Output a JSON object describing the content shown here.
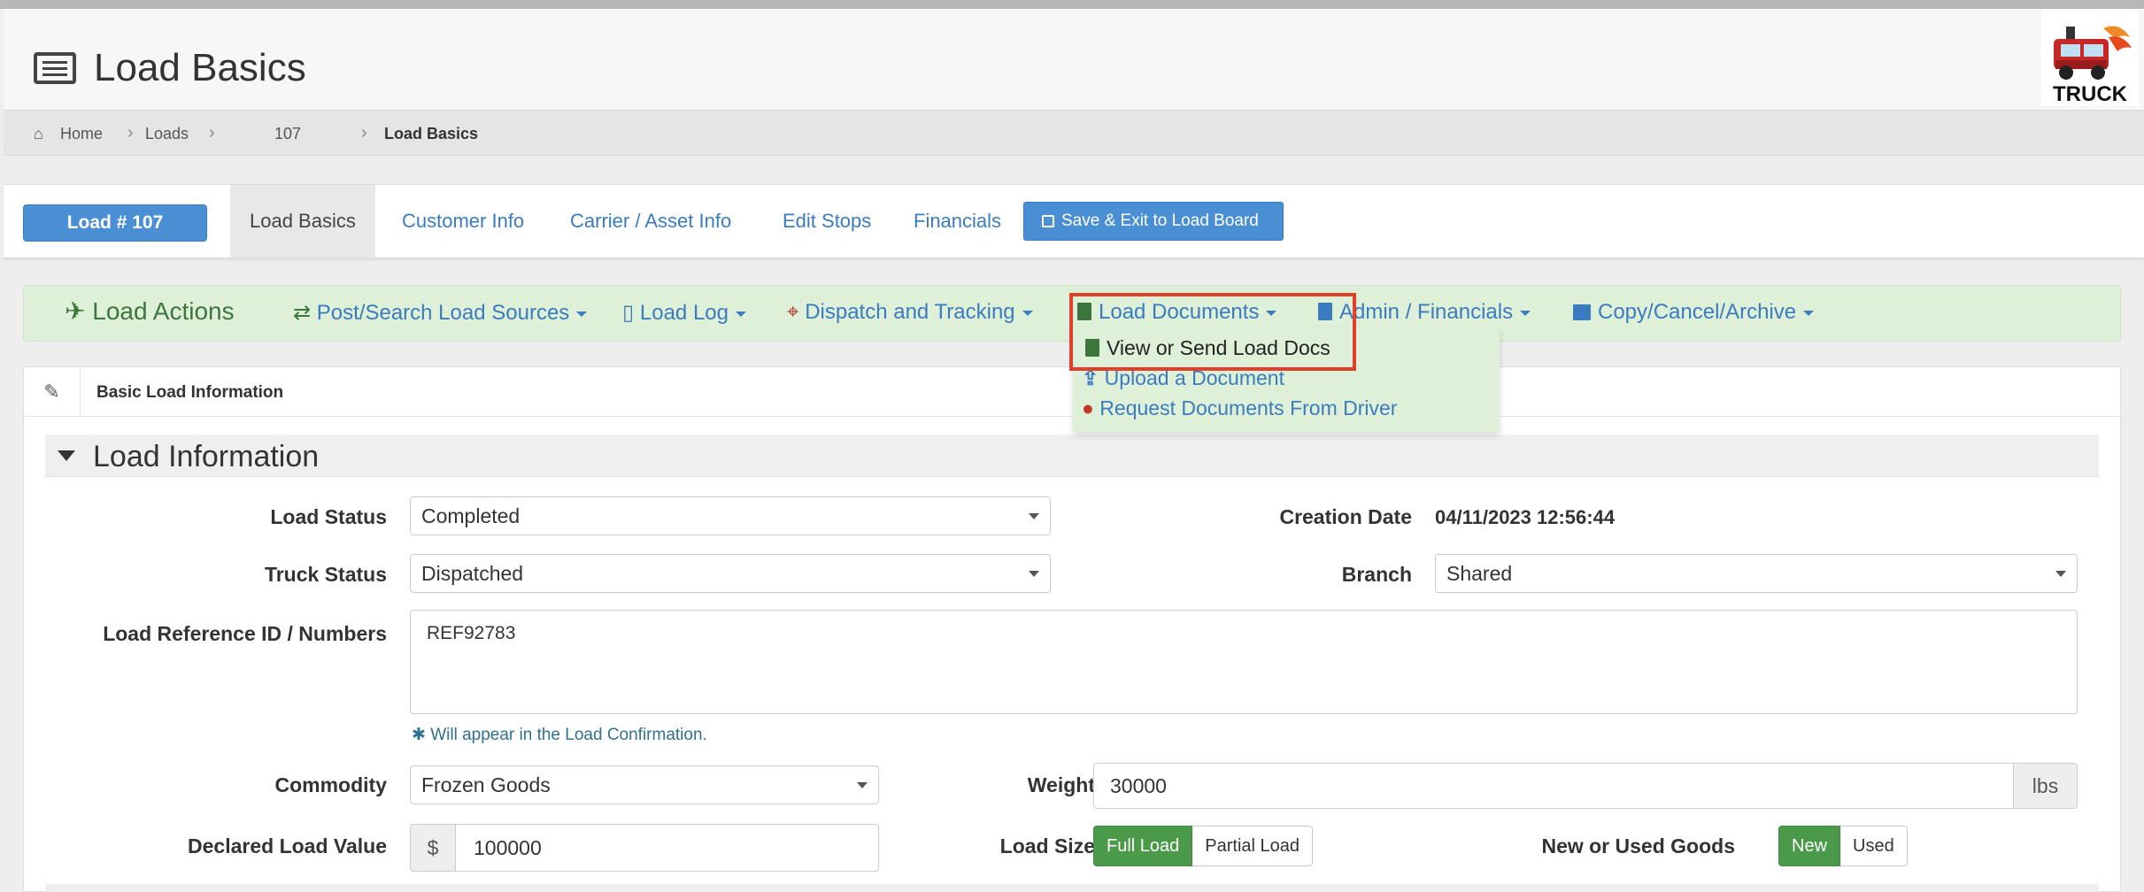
{
  "header": {
    "title": "Load Basics",
    "logo_text": "TRUCK"
  },
  "breadcrumb": [
    "Home",
    "Loads",
    "107",
    "Load Basics"
  ],
  "tabs": {
    "load_badge": "Load # 107",
    "items": [
      "Load Basics",
      "Customer Info",
      "Carrier / Asset Info",
      "Edit Stops",
      "Financials"
    ],
    "save_button": "Save & Exit to Load Board"
  },
  "actions": {
    "title": "Load Actions",
    "items": [
      "Post/Search Load Sources",
      "Load Log",
      "Dispatch and Tracking",
      "Load Documents",
      "Admin / Financials",
      "Copy/Cancel/Archive"
    ]
  },
  "dropdown": {
    "items": [
      "View or Send Load Docs",
      "Upload a Document",
      "Request Documents From Driver"
    ]
  },
  "panel": {
    "title": "Basic Load Information",
    "section": "Load Information",
    "fields": {
      "load_status": {
        "label": "Load Status",
        "value": "Completed"
      },
      "creation_date": {
        "label": "Creation Date",
        "value": "04/11/2023 12:56:44"
      },
      "truck_status": {
        "label": "Truck Status",
        "value": "Dispatched"
      },
      "branch": {
        "label": "Branch",
        "value": "Shared"
      },
      "reference": {
        "label": "Load Reference ID / Numbers",
        "value": "REF92783",
        "help": "Will appear in the Load Confirmation."
      },
      "commodity": {
        "label": "Commodity",
        "value": "Frozen Goods"
      },
      "weight": {
        "label": "Weight",
        "value": "30000",
        "unit": "lbs"
      },
      "declared_value": {
        "label": "Declared Load Value",
        "prefix": "$",
        "value": "100000"
      },
      "load_size": {
        "label": "Load Size",
        "options": [
          "Full Load",
          "Partial Load"
        ],
        "selected": "Full Load"
      },
      "goods_condition": {
        "label": "New or Used Goods",
        "options": [
          "New",
          "Used"
        ],
        "selected": "New"
      }
    }
  },
  "colors": {
    "accent": "#4a8fd4",
    "link": "#3a7cbf",
    "success_bg": "#dff0d8",
    "highlight": "#e0402a",
    "active_toggle": "#4a9a4a"
  }
}
